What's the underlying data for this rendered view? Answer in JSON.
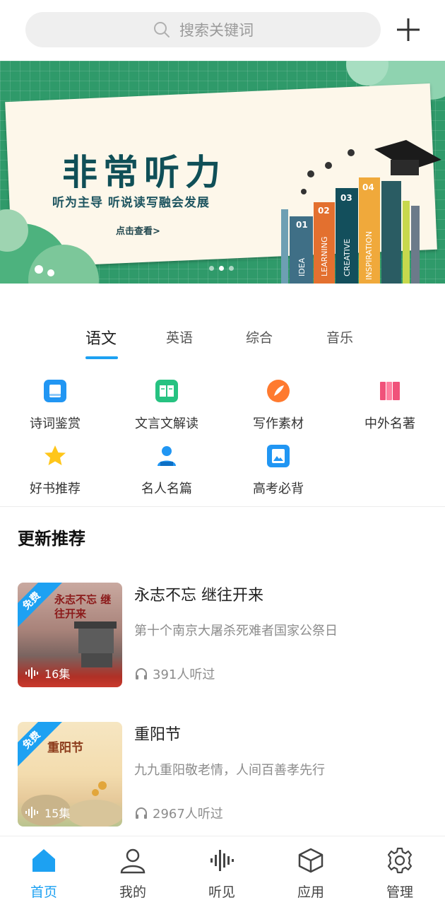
{
  "search": {
    "placeholder": "搜索关键词"
  },
  "banner": {
    "title": "非常听力",
    "subtitle": "听为主导 听说读写融会发展",
    "link": "点击查看>",
    "book_labels": [
      "01",
      "02",
      "03",
      "04"
    ],
    "book_words": [
      "IDEA",
      "LEARNING",
      "CREATIVE",
      "INSPIRATION"
    ]
  },
  "tabs": [
    {
      "label": "语文",
      "active": true
    },
    {
      "label": "英语",
      "active": false
    },
    {
      "label": "综合",
      "active": false
    },
    {
      "label": "音乐",
      "active": false
    }
  ],
  "categories": [
    {
      "label": "诗词鉴赏",
      "icon": "book-icon",
      "color": "#2196f3"
    },
    {
      "label": "文言文解读",
      "icon": "open-book-icon",
      "color": "#26c281"
    },
    {
      "label": "写作素材",
      "icon": "feather-icon",
      "color": "#ff7a2f"
    },
    {
      "label": "中外名著",
      "icon": "books-icon",
      "color": "#f0527a"
    },
    {
      "label": "好书推荐",
      "icon": "star-icon",
      "color": "#ffc61a"
    },
    {
      "label": "名人名篇",
      "icon": "person-icon",
      "color": "#2196f3"
    },
    {
      "label": "高考必背",
      "icon": "image-icon",
      "color": "#2196f3"
    }
  ],
  "section": {
    "title": "更新推荐"
  },
  "items": [
    {
      "title": "永志不忘 继往开来",
      "desc": "第十个南京大屠杀死难者国家公祭日",
      "listens": "391人听过",
      "episodes": "16集",
      "badge": "免费",
      "thumb_text": "永志不忘 继往开来"
    },
    {
      "title": "重阳节",
      "desc": "九九重阳敬老情，人间百善孝先行",
      "listens": "2967人听过",
      "episodes": "15集",
      "badge": "免费",
      "thumb_text": "重阳节"
    }
  ],
  "nav": [
    {
      "label": "首页",
      "icon": "home-icon",
      "active": true
    },
    {
      "label": "我的",
      "icon": "user-icon",
      "active": false
    },
    {
      "label": "听见",
      "icon": "audio-wave-icon",
      "active": false
    },
    {
      "label": "应用",
      "icon": "cube-icon",
      "active": false
    },
    {
      "label": "管理",
      "icon": "gear-icon",
      "active": false
    }
  ],
  "colors": {
    "accent": "#1da1f2",
    "banner_green": "#2f9a6a"
  }
}
